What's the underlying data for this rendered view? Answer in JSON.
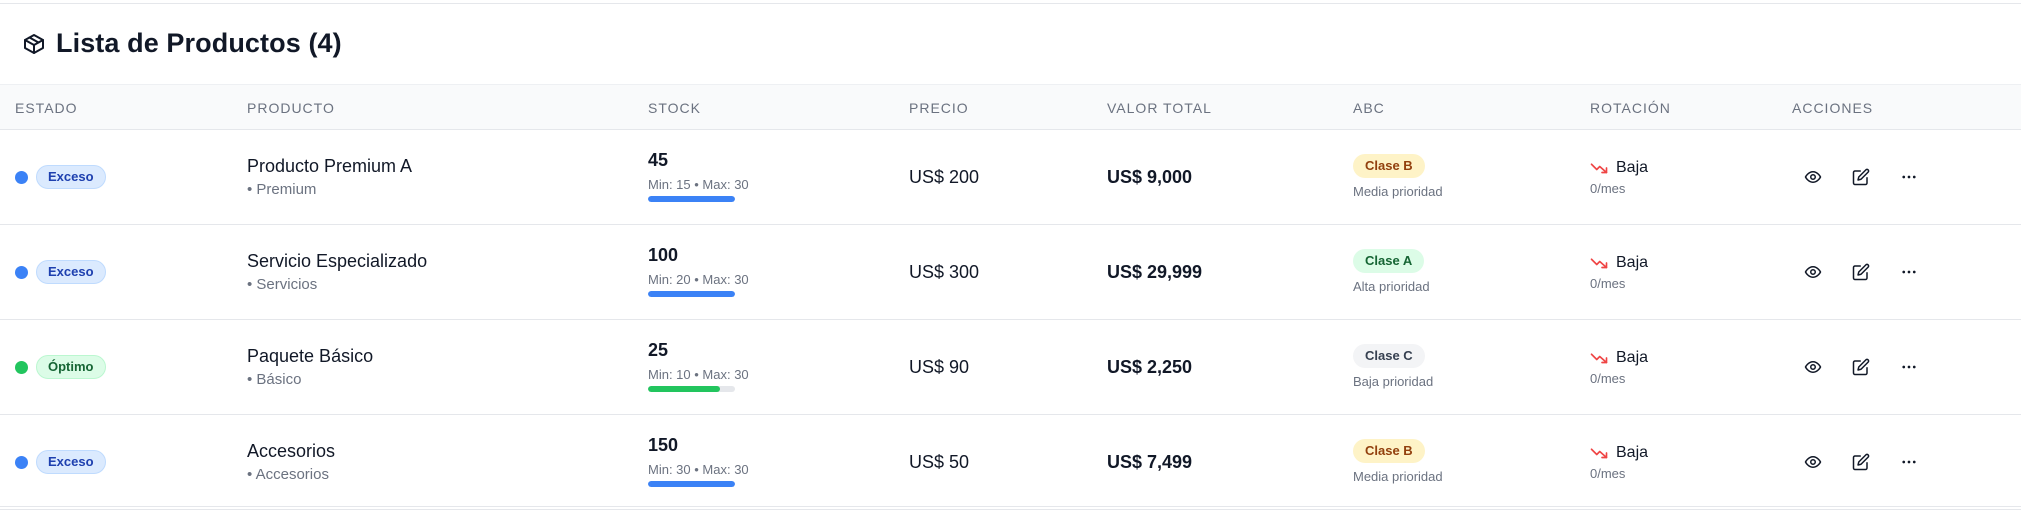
{
  "header": {
    "title": "Lista de Productos (4)",
    "icon": "package-icon"
  },
  "columns": {
    "estado": "ESTADO",
    "producto": "PRODUCTO",
    "stock": "STOCK",
    "precio": "PRECIO",
    "valor_total": "VALOR TOTAL",
    "abc": "ABC",
    "rotacion": "ROTACIÓN",
    "acciones": "ACCIONES"
  },
  "colors": {
    "blue": "#3b82f6",
    "green": "#22c55e",
    "exceso_bg": "#dbeafe",
    "exceso_text": "#1e40af",
    "optimo_bg": "#dcfce7",
    "optimo_text": "#166534",
    "clase_a_bg": "#dcfce7",
    "clase_b_bg": "#fef3c7",
    "clase_c_bg": "#f3f4f6",
    "trend_down": "#ef4444"
  },
  "rows": [
    {
      "estado": "Exceso",
      "estado_color": "#3b82f6",
      "estado_bg": "#dbeafe",
      "estado_border": "#bfdbfe",
      "estado_text_color": "#1e40af",
      "producto": "Producto Premium A",
      "categoria": "• Premium",
      "stock": "45",
      "stock_range": "Min: 15 • Max: 30",
      "stock_fill_pct": 100,
      "stock_fill_color": "#3b82f6",
      "precio": "US$ 200",
      "valor_total": "US$ 9,000",
      "abc": "Clase B",
      "abc_bg": "#fef3c7",
      "abc_text_color": "#92400e",
      "abc_prioridad": "Media prioridad",
      "rotacion": "Baja",
      "rotacion_sub": "0/mes"
    },
    {
      "estado": "Exceso",
      "estado_color": "#3b82f6",
      "estado_bg": "#dbeafe",
      "estado_border": "#bfdbfe",
      "estado_text_color": "#1e40af",
      "producto": "Servicio Especializado",
      "categoria": "• Servicios",
      "stock": "100",
      "stock_range": "Min: 20 • Max: 30",
      "stock_fill_pct": 100,
      "stock_fill_color": "#3b82f6",
      "precio": "US$ 300",
      "valor_total": "US$ 29,999",
      "abc": "Clase A",
      "abc_bg": "#dcfce7",
      "abc_text_color": "#166534",
      "abc_prioridad": "Alta prioridad",
      "rotacion": "Baja",
      "rotacion_sub": "0/mes"
    },
    {
      "estado": "Óptimo",
      "estado_color": "#22c55e",
      "estado_bg": "#dcfce7",
      "estado_border": "#bbf7d0",
      "estado_text_color": "#166534",
      "producto": "Paquete Básico",
      "categoria": "• Básico",
      "stock": "25",
      "stock_range": "Min: 10 • Max: 30",
      "stock_fill_pct": 83,
      "stock_fill_color": "#22c55e",
      "precio": "US$ 90",
      "valor_total": "US$ 2,250",
      "abc": "Clase C",
      "abc_bg": "#f3f4f6",
      "abc_text_color": "#374151",
      "abc_prioridad": "Baja prioridad",
      "rotacion": "Baja",
      "rotacion_sub": "0/mes"
    },
    {
      "estado": "Exceso",
      "estado_color": "#3b82f6",
      "estado_bg": "#dbeafe",
      "estado_border": "#bfdbfe",
      "estado_text_color": "#1e40af",
      "producto": "Accesorios",
      "categoria": "• Accesorios",
      "stock": "150",
      "stock_range": "Min: 30 • Max: 30",
      "stock_fill_pct": 100,
      "stock_fill_color": "#3b82f6",
      "precio": "US$ 50",
      "valor_total": "US$ 7,499",
      "abc": "Clase B",
      "abc_bg": "#fef3c7",
      "abc_text_color": "#92400e",
      "abc_prioridad": "Media prioridad",
      "rotacion": "Baja",
      "rotacion_sub": "0/mes"
    }
  ],
  "actions": {
    "view_icon": "eye-icon",
    "edit_icon": "edit-icon",
    "more_icon": "more-horizontal-icon"
  }
}
